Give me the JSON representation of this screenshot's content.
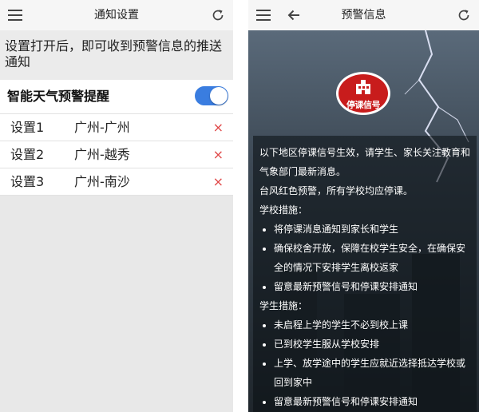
{
  "left_screen": {
    "header": {
      "title": "通知设置",
      "menu_icon": "hamburger-menu-icon",
      "refresh_icon": "refresh-icon"
    },
    "notice": "设置打开后，即可收到预警信息的推送通知",
    "toggle": {
      "label": "智能天气预警提醒",
      "on": true,
      "color": "#3a7de0"
    },
    "settings": [
      {
        "name": "设置1",
        "location": "广州-广州",
        "delete": "×"
      },
      {
        "name": "设置2",
        "location": "广州-越秀",
        "delete": "×"
      },
      {
        "name": "设置3",
        "location": "广州-南沙",
        "delete": "×"
      }
    ]
  },
  "right_screen": {
    "header": {
      "title": "预警信息",
      "menu_icon": "hamburger-menu-icon",
      "back_icon": "back-arrow-icon",
      "refresh_icon": "refresh-icon"
    },
    "signal": {
      "label": "停课信号",
      "color": "#c81c1c"
    },
    "intro": "以下地区停课信号生效，请学生、家长关注教育和气象部门最新消息。",
    "alert": "台风红色预警，所有学校均应停课。",
    "school_heading": "学校措施：",
    "school_items": [
      "将停课消息通知到家长和学生",
      "确保校舍开放，保障在校学生安全，在确保安全的情况下安排学生离校返家",
      "留意最新预警信号和停课安排通知"
    ],
    "student_heading": "学生措施：",
    "student_items": [
      "未启程上学的学生不必到校上课",
      "已到校学生服从学校安排",
      "上学、放学途中的学生应就近选择抵达学校或回到家中",
      "留意最新预警信号和停课安排通知"
    ]
  }
}
